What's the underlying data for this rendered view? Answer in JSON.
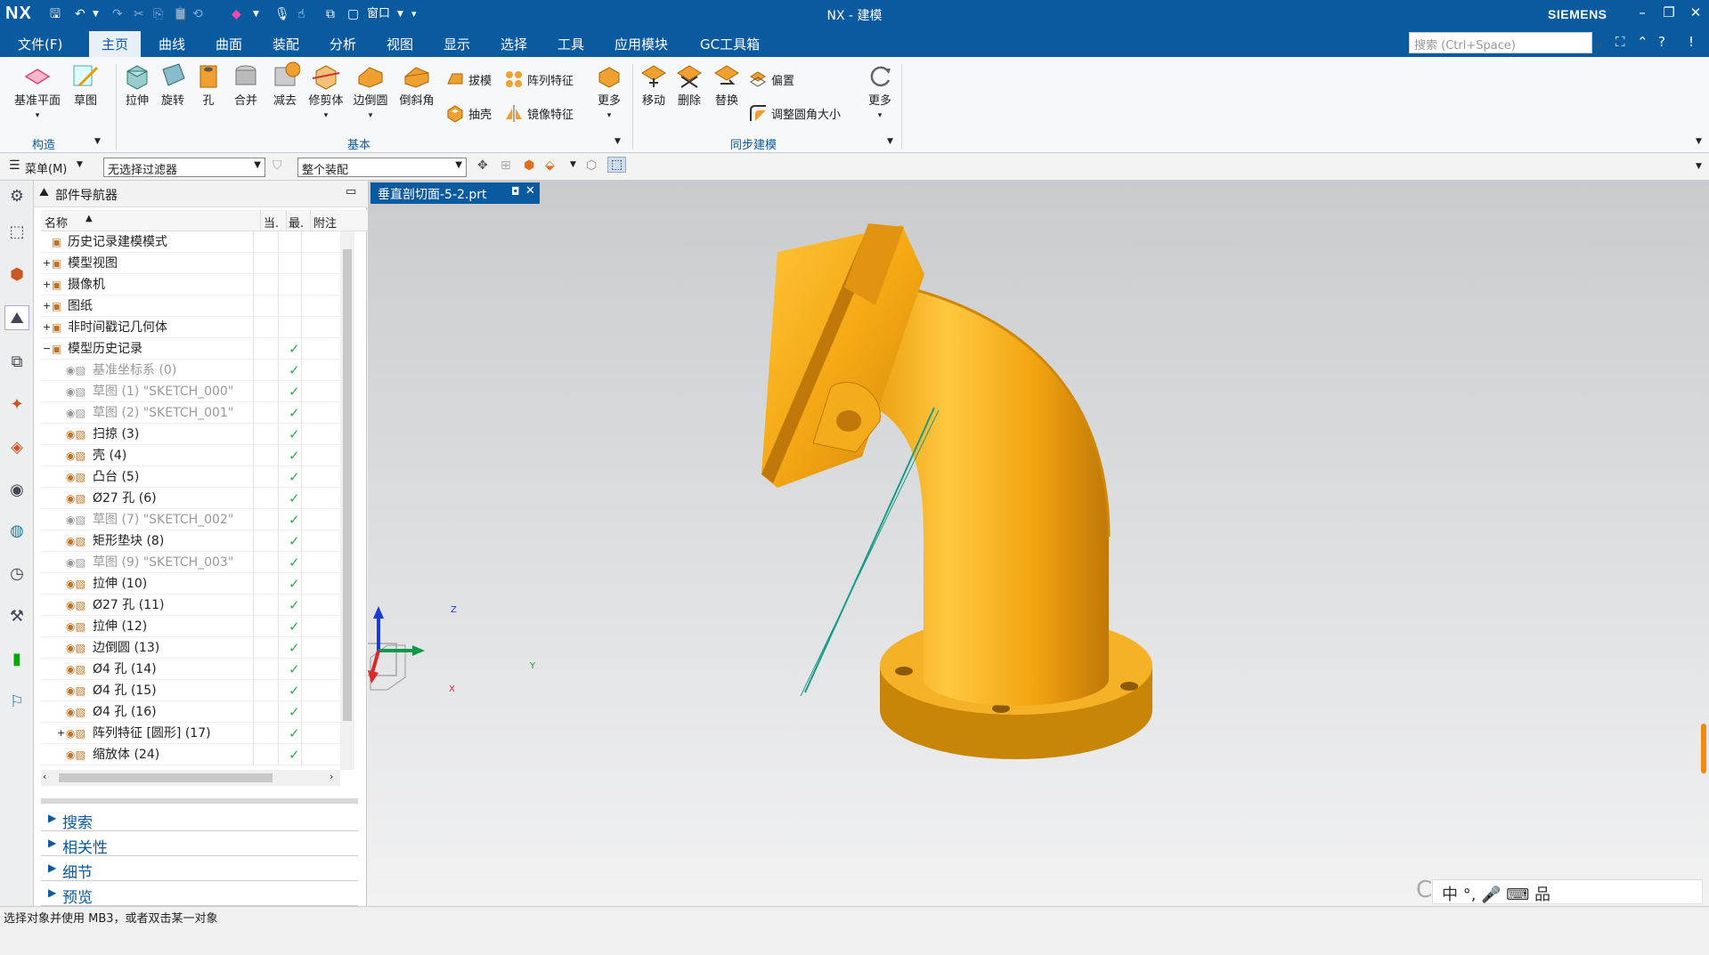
{
  "titlebar": {
    "logo": "NX",
    "window_label": "窗口",
    "title": "NX - 建模",
    "brand": "SIEMENS"
  },
  "menubar": {
    "items": [
      "文件(F)",
      "主页",
      "曲线",
      "曲面",
      "装配",
      "分析",
      "视图",
      "显示",
      "选择",
      "工具",
      "应用模块",
      "GC工具箱"
    ],
    "search_placeholder": "搜索 (Ctrl+Space)"
  },
  "ribbon": {
    "construct": {
      "datum_plane": "基准平面",
      "sketch": "草图",
      "group": "构造"
    },
    "basic": {
      "extrude": "拉伸",
      "revolve": "旋转",
      "hole": "孔",
      "unite": "合并",
      "subtract": "减去",
      "trim_body": "修剪体",
      "edge_blend": "边倒圆",
      "chamfer": "倒斜角",
      "draft": "拔模",
      "pattern": "阵列特征",
      "shell": "抽壳",
      "mirror": "镜像特征",
      "more": "更多",
      "group": "基本"
    },
    "sync": {
      "move": "移动",
      "delete": "删除",
      "replace": "替换",
      "offset": "偏置",
      "resize_blend": "调整圆角大小",
      "more": "更多",
      "group": "同步建模"
    }
  },
  "toolbar2": {
    "menu": "菜单(M)",
    "filter": "无选择过滤器",
    "scope": "整个装配"
  },
  "navigator": {
    "title": "部件导航器",
    "columns": {
      "name": "名称",
      "current": "当.",
      "latest": "最.",
      "note": "附注"
    },
    "rows": [
      {
        "label": "历史记录建模模式",
        "indent": 1,
        "check": false,
        "grey": false,
        "expander": ""
      },
      {
        "label": "模型视图",
        "indent": 1,
        "check": false,
        "grey": false,
        "expander": "+"
      },
      {
        "label": "摄像机",
        "indent": 1,
        "check": false,
        "grey": false,
        "expander": "+"
      },
      {
        "label": "图纸",
        "indent": 1,
        "check": false,
        "grey": false,
        "expander": "+"
      },
      {
        "label": "非时间戳记几何体",
        "indent": 1,
        "check": false,
        "grey": false,
        "expander": "+"
      },
      {
        "label": "模型历史记录",
        "indent": 1,
        "check": true,
        "grey": false,
        "expander": "−"
      },
      {
        "label": "基准坐标系 (0)",
        "indent": 2,
        "check": true,
        "grey": true,
        "expander": ""
      },
      {
        "label": "草图 (1) \"SKETCH_000\"",
        "indent": 2,
        "check": true,
        "grey": true,
        "expander": ""
      },
      {
        "label": "草图 (2) \"SKETCH_001\"",
        "indent": 2,
        "check": true,
        "grey": true,
        "expander": ""
      },
      {
        "label": "扫掠 (3)",
        "indent": 2,
        "check": true,
        "grey": false,
        "expander": ""
      },
      {
        "label": "壳 (4)",
        "indent": 2,
        "check": true,
        "grey": false,
        "expander": ""
      },
      {
        "label": "凸台 (5)",
        "indent": 2,
        "check": true,
        "grey": false,
        "expander": ""
      },
      {
        "label": "Ø27 孔 (6)",
        "indent": 2,
        "check": true,
        "grey": false,
        "expander": ""
      },
      {
        "label": "草图 (7) \"SKETCH_002\"",
        "indent": 2,
        "check": true,
        "grey": true,
        "expander": ""
      },
      {
        "label": "矩形垫块 (8)",
        "indent": 2,
        "check": true,
        "grey": false,
        "expander": ""
      },
      {
        "label": "草图 (9) \"SKETCH_003\"",
        "indent": 2,
        "check": true,
        "grey": true,
        "expander": ""
      },
      {
        "label": "拉伸 (10)",
        "indent": 2,
        "check": true,
        "grey": false,
        "expander": ""
      },
      {
        "label": "Ø27 孔 (11)",
        "indent": 2,
        "check": true,
        "grey": false,
        "expander": ""
      },
      {
        "label": "拉伸 (12)",
        "indent": 2,
        "check": true,
        "grey": false,
        "expander": ""
      },
      {
        "label": "边倒圆 (13)",
        "indent": 2,
        "check": true,
        "grey": false,
        "expander": ""
      },
      {
        "label": "Ø4 孔 (14)",
        "indent": 2,
        "check": true,
        "grey": false,
        "expander": ""
      },
      {
        "label": "Ø4 孔 (15)",
        "indent": 2,
        "check": true,
        "grey": false,
        "expander": ""
      },
      {
        "label": "Ø4 孔 (16)",
        "indent": 2,
        "check": true,
        "grey": false,
        "expander": ""
      },
      {
        "label": "阵列特征 [圆形] (17)",
        "indent": 2,
        "check": true,
        "grey": false,
        "expander": "+"
      },
      {
        "label": "缩放体 (24)",
        "indent": 2,
        "check": true,
        "grey": false,
        "expander": ""
      }
    ],
    "sections": [
      "搜索",
      "相关性",
      "细节",
      "预览"
    ]
  },
  "graphics": {
    "doc_tab": "垂直剖切面-5-2.prt",
    "triad": {
      "z": "Z",
      "y": "Y",
      "x": "X"
    }
  },
  "statusbar": {
    "text": "选择对象并使用 MB3，或者双击某一对象"
  },
  "overlay": {
    "watermark": "CSDN",
    "ime": "中  °,  🎤  ⌨  品"
  },
  "colors": {
    "accent": "#0a5aa0",
    "model": "#f0a010",
    "section_plane": "#1a9a8a"
  }
}
